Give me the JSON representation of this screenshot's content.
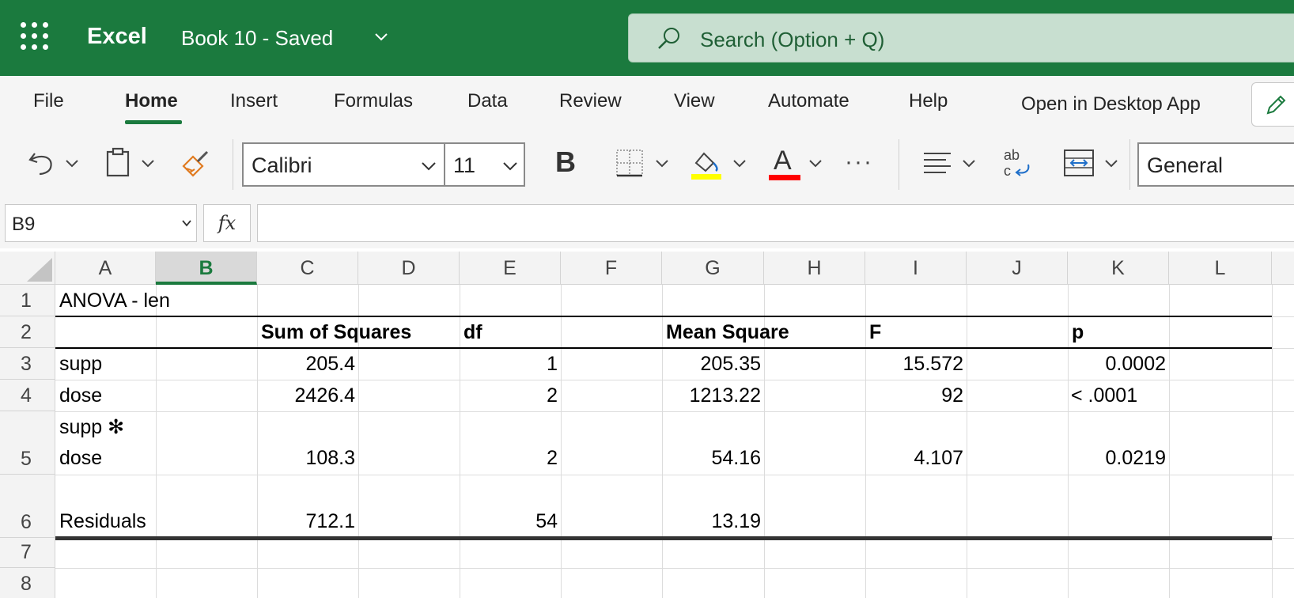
{
  "app": {
    "name": "Excel",
    "doc_title": "Book 10  -  Saved"
  },
  "search": {
    "placeholder": "Search (Option + Q)"
  },
  "ribbon": {
    "tabs": [
      "File",
      "Home",
      "Insert",
      "Formulas",
      "Data",
      "Review",
      "View",
      "Automate",
      "Help"
    ],
    "active_tab": "Home",
    "open_desktop": "Open in Desktop App"
  },
  "toolbar": {
    "font_name": "Calibri",
    "font_size": "11",
    "bold_label": "B",
    "font_color_label": "A",
    "more_label": "···",
    "number_format": "General",
    "fill_color": "#ffff00",
    "font_color": "#ff0000"
  },
  "formula_bar": {
    "name_box": "B9",
    "fx_label": "fx",
    "formula": ""
  },
  "grid": {
    "columns": [
      "A",
      "B",
      "C",
      "D",
      "E",
      "F",
      "G",
      "H",
      "I",
      "J",
      "K",
      "L"
    ],
    "selected_column": "B",
    "rows": [
      "1",
      "2",
      "3",
      "4",
      "5",
      "6",
      "7",
      "8"
    ],
    "table": {
      "title": "ANOVA - len",
      "headers": {
        "sum_sq": "Sum of Squares",
        "df": "df",
        "mean_sq": "Mean Square",
        "f": "F",
        "p": "p"
      },
      "data": [
        {
          "term": "supp",
          "sum_sq": "205.4",
          "df": "1",
          "mean_sq": "205.35",
          "f": "15.572",
          "p": "0.0002"
        },
        {
          "term": "dose",
          "sum_sq": "2426.4",
          "df": "2",
          "mean_sq": "1213.22",
          "f": "92",
          "p": "< .0001"
        },
        {
          "term_line1": "supp ✻",
          "term_line2": "dose",
          "sum_sq": "108.3",
          "df": "2",
          "mean_sq": "54.16",
          "f": "4.107",
          "p": "0.0219"
        },
        {
          "term": "Residuals",
          "sum_sq": "712.1",
          "df": "54",
          "mean_sq": "13.19"
        }
      ]
    }
  }
}
